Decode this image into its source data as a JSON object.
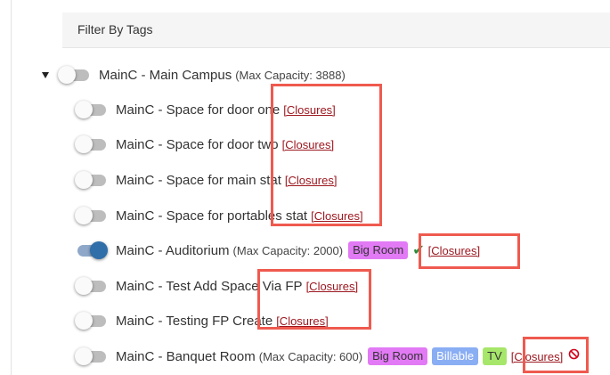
{
  "filter": {
    "label": "Filter By Tags"
  },
  "tree": {
    "root": {
      "name": "MainC - Main Campus",
      "capacity": "(Max Capacity: 3888)"
    },
    "items": [
      {
        "name": "MainC - Space for door one",
        "closures": "[Closures]"
      },
      {
        "name": "MainC - Space for door two",
        "closures": "[Closures]"
      },
      {
        "name": "MainC - Space for main stat",
        "closures": "[Closures]"
      },
      {
        "name": "MainC - Space for portables stat",
        "closures": "[Closures]"
      },
      {
        "name": "MainC - Auditorium",
        "capacity": "(Max Capacity: 2000)",
        "tags": [
          "Big Room"
        ],
        "closures": "[Closures]"
      },
      {
        "name": "MainC - Test Add Space Via FP",
        "closures": "[Closures]"
      },
      {
        "name": "MainC - Testing FP Create",
        "closures": "[Closures]"
      },
      {
        "name": "MainC - Banquet Room",
        "capacity": "(Max Capacity: 600)",
        "tags": [
          "Big Room",
          "Billable",
          "TV"
        ],
        "closures": "[Closures]"
      }
    ]
  },
  "colors": {
    "highlight": "#ef5a4f",
    "link": "#9c1820",
    "toggle_on": "#2f6ea9",
    "tag_big_room": "#e27af5",
    "tag_billable": "#8aaef3",
    "tag_tv": "#a6e66a",
    "check": "#2e8b3a",
    "ban": "#d0021b"
  },
  "icons": {
    "expand": "caret-down-icon",
    "active": "check-icon",
    "blocked": "ban-icon"
  }
}
